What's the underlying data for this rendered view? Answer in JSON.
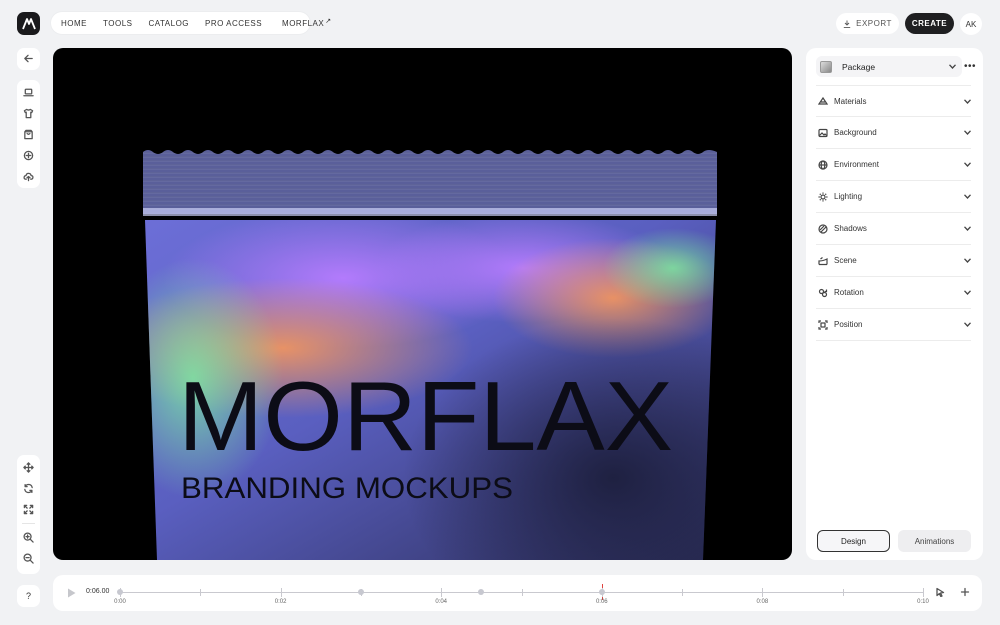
{
  "app": {
    "logo_icon": "morflax-logo-icon"
  },
  "topnav": {
    "items": [
      "HOME",
      "TOOLS",
      "CATALOG",
      "PRO ACCESS"
    ],
    "external_link": "MORFLAX",
    "external_icon": "external-arrow-icon"
  },
  "header_actions": {
    "export_label": "EXPORT",
    "create_label": "CREATE",
    "avatar_initials": "AK"
  },
  "sidebar": {
    "back_icon": "arrow-left-icon",
    "tools": [
      "laptop-icon",
      "tshirt-icon",
      "package-box-icon",
      "sticker-icon",
      "upload-cloud-icon"
    ],
    "view_tools": [
      "move-icon",
      "rotate-icon",
      "fit-screen-icon",
      "zoom-in-icon",
      "zoom-out-icon"
    ],
    "help_label": "?"
  },
  "canvas": {
    "product_text": "MORFLAX",
    "product_subtext": "BRANDING MOCKUPS",
    "background_color": "#000000"
  },
  "panel": {
    "selected_model": "Package",
    "more_label": "•••",
    "sections": [
      {
        "label": "Materials",
        "icon": "materials-icon"
      },
      {
        "label": "Background",
        "icon": "image-icon"
      },
      {
        "label": "Environment",
        "icon": "globe-icon"
      },
      {
        "label": "Lighting",
        "icon": "sun-icon"
      },
      {
        "label": "Shadows",
        "icon": "shadow-icon"
      },
      {
        "label": "Scene",
        "icon": "scene-icon"
      },
      {
        "label": "Rotation",
        "icon": "rotation-icon"
      },
      {
        "label": "Position",
        "icon": "position-icon"
      }
    ],
    "tabs": {
      "design": "Design",
      "animations": "Animations"
    },
    "active_tab": "Design"
  },
  "timeline": {
    "current_time": "0:06.00",
    "labels": [
      "0:00",
      "0:02",
      "0:04",
      "0:06",
      "0:08",
      "0:10"
    ],
    "duration_seconds": 10,
    "playhead_seconds": 6,
    "keyframes_seconds": [
      0,
      3,
      4.5,
      6
    ],
    "accent_color": "#e0433f"
  }
}
